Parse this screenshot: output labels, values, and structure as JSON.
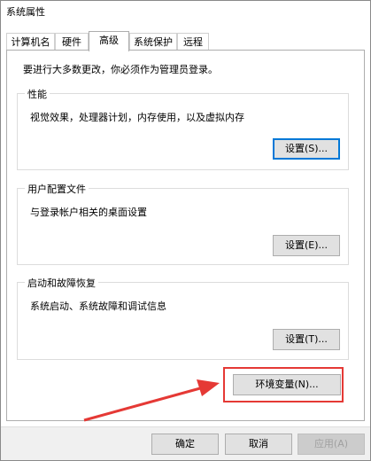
{
  "window": {
    "title": "系统属性"
  },
  "tabs": [
    {
      "label": "计算机名",
      "active": false
    },
    {
      "label": "硬件",
      "active": false
    },
    {
      "label": "高级",
      "active": true
    },
    {
      "label": "系统保护",
      "active": false
    },
    {
      "label": "远程",
      "active": false
    }
  ],
  "notice": "要进行大多数更改，你必须作为管理员登录。",
  "groups": {
    "performance": {
      "title": "性能",
      "desc": "视觉效果，处理器计划，内存使用，以及虚拟内存",
      "button": "设置(S)..."
    },
    "user_profiles": {
      "title": "用户配置文件",
      "desc": "与登录帐户相关的桌面设置",
      "button": "设置(E)..."
    },
    "startup_recovery": {
      "title": "启动和故障恢复",
      "desc": "系统启动、系统故障和调试信息",
      "button": "设置(T)..."
    }
  },
  "env_button": "环境变量(N)...",
  "footer": {
    "ok": "确定",
    "cancel": "取消",
    "apply": "应用(A)"
  },
  "colors": {
    "annotation": "#e53935",
    "focus": "#0078d7"
  }
}
